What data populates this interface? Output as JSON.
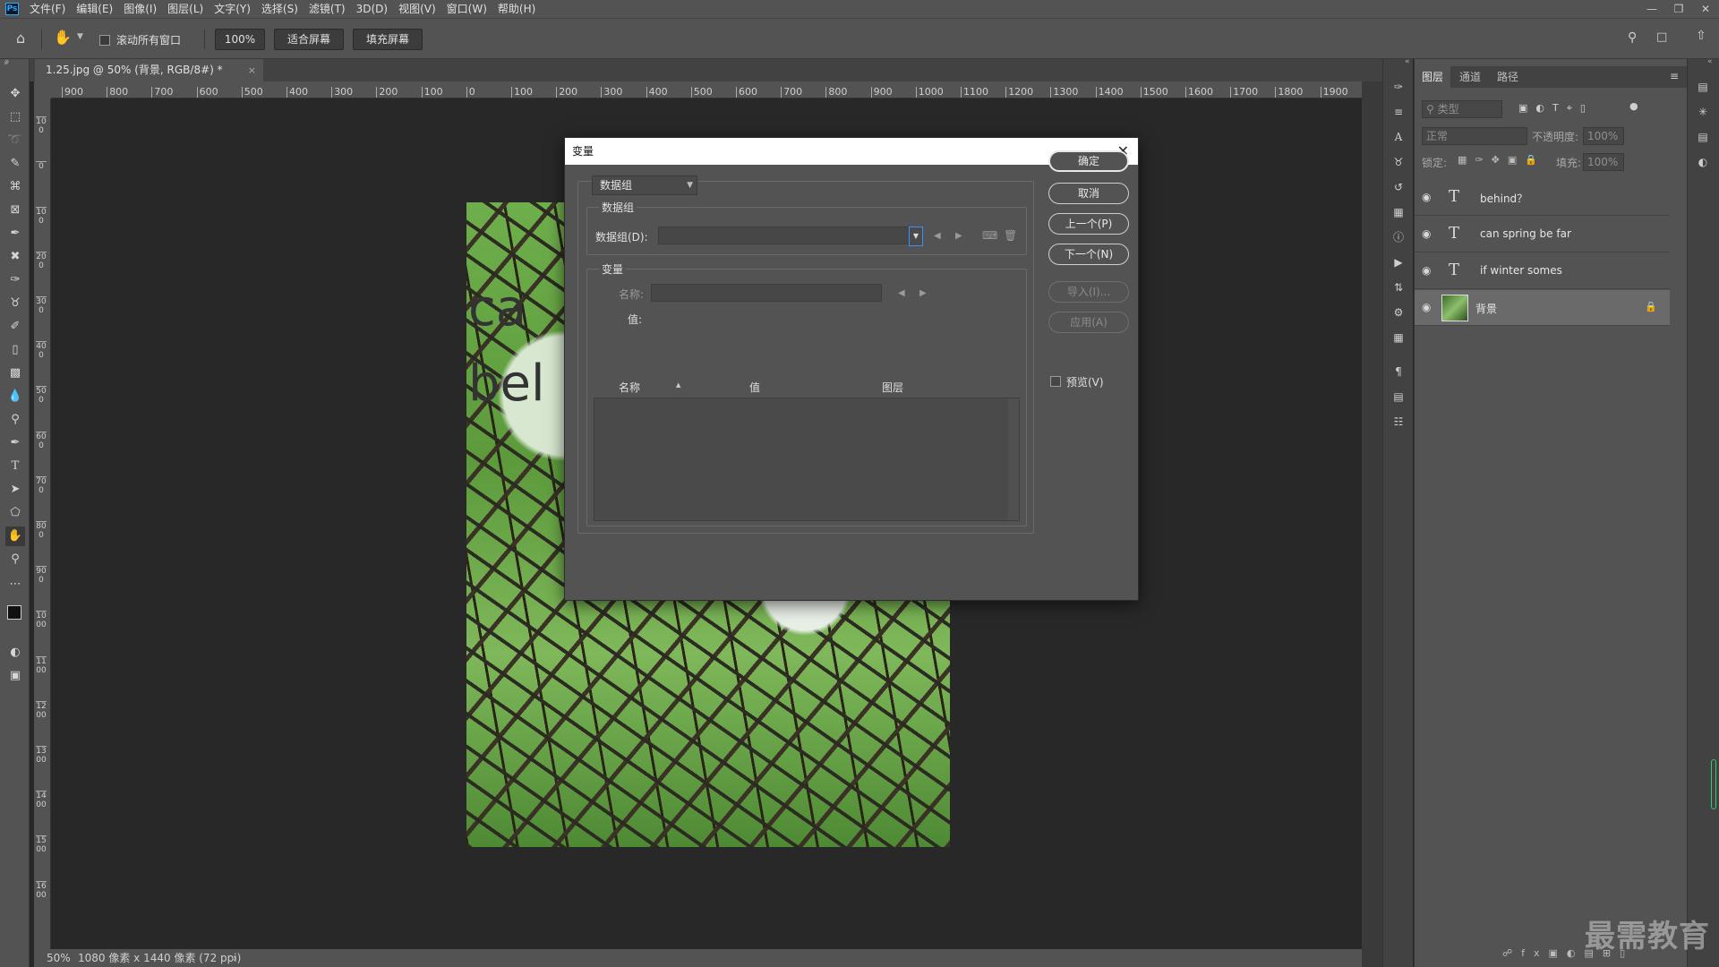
{
  "menubar": {
    "app_logo": "Ps",
    "items": [
      "文件(F)",
      "编辑(E)",
      "图像(I)",
      "图层(L)",
      "文字(Y)",
      "选择(S)",
      "滤镜(T)",
      "3D(D)",
      "视图(V)",
      "窗口(W)",
      "帮助(H)"
    ]
  },
  "options": {
    "scroll_all_label": "滚动所有窗口",
    "zoom_value": "100%",
    "fit_screen": "适合屏幕",
    "fill_screen": "填充屏幕"
  },
  "document": {
    "tab_title": "1.25.jpg @ 50% (背景, RGB/8#) *",
    "close_glyph": "×",
    "canvas_text_1": "ca",
    "canvas_text_2": "bel"
  },
  "ruler": {
    "h_ticks": [
      "900",
      "800",
      "700",
      "600",
      "500",
      "400",
      "300",
      "200",
      "100",
      "0",
      "100",
      "200",
      "300",
      "400",
      "500",
      "600",
      "700",
      "800",
      "900",
      "1000",
      "1100",
      "1200",
      "1300",
      "1400",
      "1500",
      "1600",
      "1700",
      "1800",
      "1900"
    ],
    "v_ticks": [
      "200",
      "100",
      "0",
      "100",
      "200",
      "300",
      "400",
      "500",
      "600",
      "700",
      "800",
      "900",
      "1000",
      "1100",
      "1200",
      "1300",
      "1400",
      "1500",
      "1600"
    ]
  },
  "status": {
    "zoom": "50%",
    "info": "1080 像素 x 1440 像素 (72 ppi)"
  },
  "layers_panel": {
    "tabs": [
      "图层",
      "通道",
      "路径"
    ],
    "filter_placeholder": "类型",
    "blend_mode": "正常",
    "opacity_label": "不透明度:",
    "opacity_value": "100%",
    "lock_label": "锁定:",
    "fill_label": "填充:",
    "fill_value": "100%",
    "layers": [
      {
        "name": "behind？",
        "type": "text"
      },
      {
        "name": "can spring be far",
        "type": "text"
      },
      {
        "name": "if winter somes",
        "type": "text"
      },
      {
        "name": "背景",
        "type": "image",
        "locked": true
      }
    ]
  },
  "dialog": {
    "title": "变量",
    "mode_select": "数据组",
    "dataset_group_title": "数据组",
    "dataset_label": "数据组(D):",
    "variable_group_title": "变量",
    "name_label": "名称:",
    "value_label": "值:",
    "table_headers": [
      "名称",
      "值",
      "图层"
    ],
    "buttons": {
      "ok": "确定",
      "cancel": "取消",
      "prev": "上一个(P)",
      "next": "下一个(N)",
      "import": "导入(I)...",
      "apply": "应用(A)"
    },
    "preview_label": "预览(V)"
  },
  "watermark": "最需教育"
}
